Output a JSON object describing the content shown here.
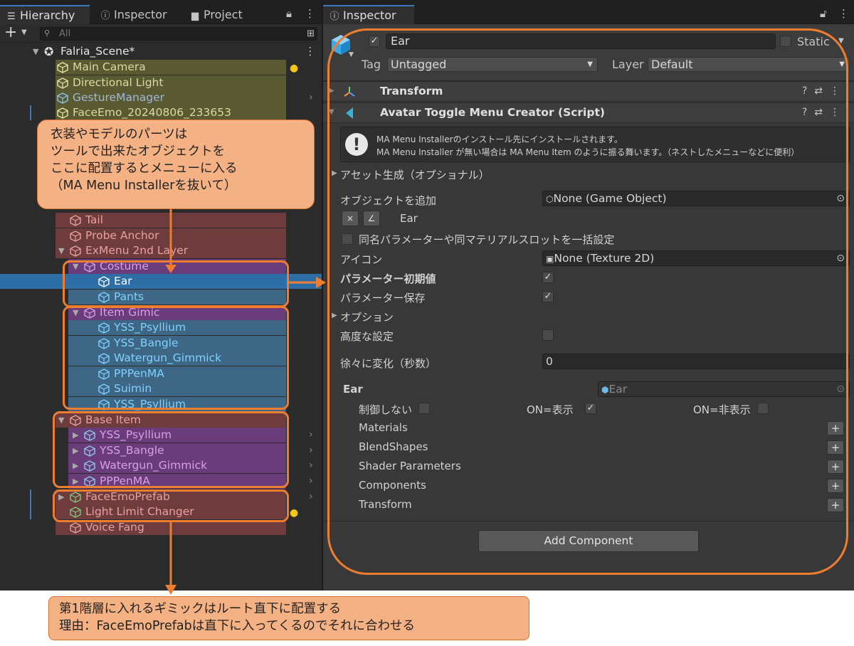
{
  "left_panel": {
    "tabs": [
      {
        "label": "Hierarchy",
        "icon": "list-icon"
      },
      {
        "label": "Inspector",
        "icon": "info-icon"
      },
      {
        "label": "Project",
        "icon": "folder-icon"
      }
    ],
    "search_placeholder": "All",
    "scene_name": "Falria_Scene*",
    "hierarchy_items": [
      {
        "name": "Main Camera",
        "text_color": "#d9d9a0"
      },
      {
        "name": "Directional Light",
        "text_color": "#d9d9a0"
      },
      {
        "name": "GestureManager",
        "text_color": "#9fb8d8"
      },
      {
        "name": "FaceEmo_20240806_233653",
        "text_color": "#d9d9a0"
      },
      {
        "name": "Tail",
        "text_color": "#e8a0a0"
      },
      {
        "name": "Probe Anchor",
        "text_color": "#e8a0a0"
      },
      {
        "name": "ExMenu 2nd Layer",
        "text_color": "#e8a0a0"
      },
      {
        "name": "Costume",
        "text_color": "#d89ee8"
      },
      {
        "name": "Ear",
        "text_color": "#ffffff"
      },
      {
        "name": "Pants",
        "text_color": "#7fd1ff"
      },
      {
        "name": "Item Gimic",
        "text_color": "#d89ee8"
      },
      {
        "name": "YSS_Psyllium",
        "text_color": "#7fd1ff"
      },
      {
        "name": "YSS_Bangle",
        "text_color": "#7fd1ff"
      },
      {
        "name": "Watergun_Gimmick",
        "text_color": "#7fd1ff"
      },
      {
        "name": "PPPenMA",
        "text_color": "#7fd1ff"
      },
      {
        "name": "Suimin",
        "text_color": "#7fd1ff"
      },
      {
        "name": "YSS_Psyllium",
        "text_color": "#7fd1ff"
      },
      {
        "name": "Base Item",
        "text_color": "#e8a0a0"
      },
      {
        "name": "YSS_Psyllium",
        "text_color": "#d89ee8"
      },
      {
        "name": "YSS_Bangle",
        "text_color": "#d89ee8"
      },
      {
        "name": "Watergun_Gimmick",
        "text_color": "#d89ee8"
      },
      {
        "name": "PPPenMA",
        "text_color": "#d89ee8"
      },
      {
        "name": "FaceEmoPrefab",
        "text_color": "#e8a0a0"
      },
      {
        "name": "Light Limit Changer",
        "text_color": "#e8a0a0"
      },
      {
        "name": "Voice Fang",
        "text_color": "#e8a0a0"
      }
    ]
  },
  "inspector": {
    "tab_label": "Inspector",
    "object_name": "Ear",
    "static_label": "Static",
    "tag_label": "Tag",
    "tag_value": "Untagged",
    "layer_label": "Layer",
    "layer_value": "Default",
    "transform_title": "Transform",
    "component_title": "Avatar Toggle Menu Creator (Script)",
    "help_lines": [
      "MA Menu Installerのインストール先にインストールされます。",
      "MA Menu Installer が無い場合は MA Menu Item のように振る舞います。（ネストしたメニューなどに便利）"
    ],
    "asset_gen_label": "アセット生成（オプショナル）",
    "add_object_label": "オブジェクトを追加",
    "add_object_value": "None (Game Object)",
    "list_item_name": "Ear",
    "remove_button": "×",
    "rename_button": "∠",
    "bulk_setting_label": "同名パラメーターや同マテリアルスロットを一括設定",
    "icon_label": "アイコン",
    "icon_value": "None (Texture 2D)",
    "param_default_label": "パラメーター初期値",
    "param_save_label": "パラメーター保存",
    "options_label": "オプション",
    "advanced_label": "高度な設定",
    "fade_label": "徐々に変化（秒数）",
    "fade_value": "0",
    "ear_section_label": "Ear",
    "ear_object_value": "Ear",
    "no_control_label": "制御しない",
    "on_show_label": "ON=表示",
    "on_hide_label": "ON=非表示",
    "sub_sections": [
      "Materials",
      "BlendShapes",
      "Shader Parameters",
      "Components",
      "Transform"
    ],
    "add_component_label": "Add Component"
  },
  "annotations": {
    "top_callout_lines": [
      "衣装やモデルのパーツは",
      "ツールで出来たオブジェクトを",
      "ここに配置するとメニューに入る",
      "（MA Menu Installerを抜いて）"
    ],
    "bottom_callout_lines": [
      "第1階層に入れるギミックはルート直下に配置する",
      "理由：FaceEmoPrefabは直下に入ってくるのでそれに合わせる"
    ]
  },
  "colors": {
    "accent_blue": "#3a79bb",
    "annotation_orange": "#ed7d31",
    "callout_fill": "#f4b183"
  }
}
